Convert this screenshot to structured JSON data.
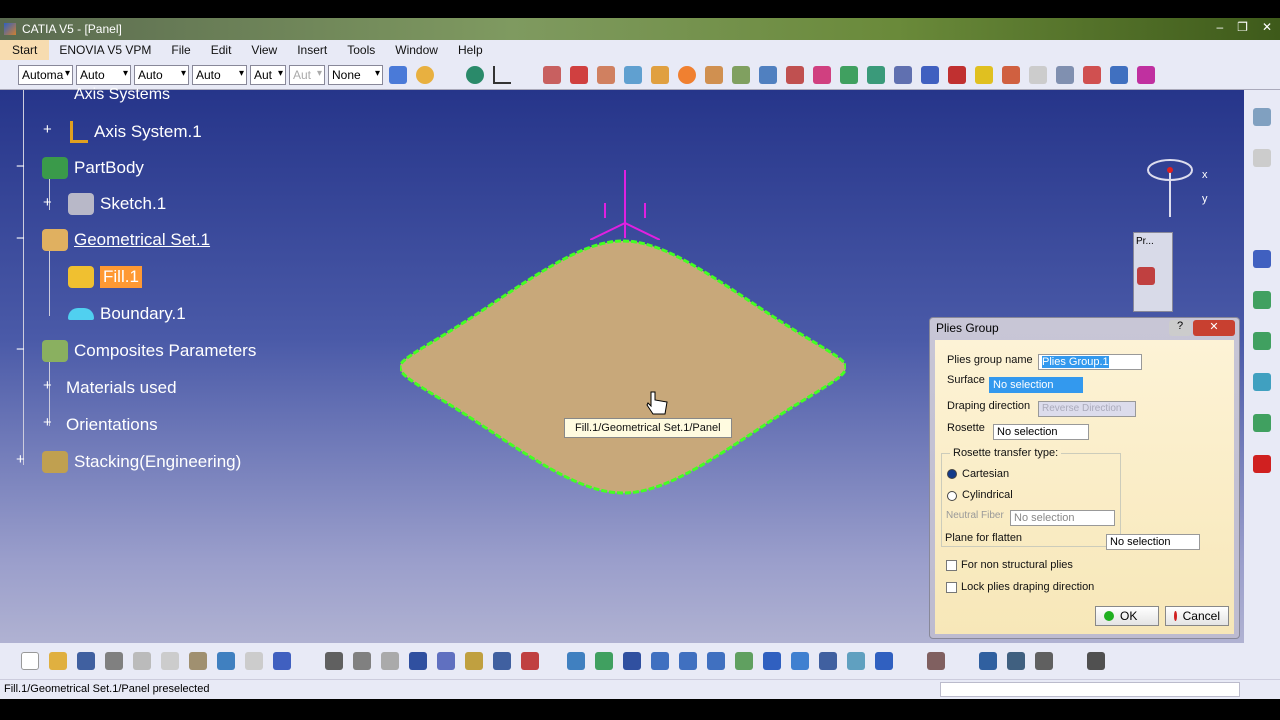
{
  "window": {
    "title": "CATIA V5 - [Panel]",
    "controls": [
      "–",
      "❐",
      "✕"
    ]
  },
  "menu": {
    "items": [
      "Start",
      "ENOVIA V5 VPM",
      "File",
      "Edit",
      "View",
      "Insert",
      "Tools",
      "Window",
      "Help"
    ]
  },
  "toolbar": {
    "selects": [
      "Automa",
      "Auto",
      "Auto",
      "Auto",
      "Aut",
      "Aut",
      "None"
    ]
  },
  "tree": {
    "items": [
      {
        "label": "Axis Systems"
      },
      {
        "label": "Axis System.1"
      },
      {
        "label": "PartBody"
      },
      {
        "label": "Sketch.1"
      },
      {
        "label": "Geometrical Set.1"
      },
      {
        "label": "Fill.1"
      },
      {
        "label": "Boundary.1"
      },
      {
        "label": "Composites Parameters"
      },
      {
        "label": "Materials used"
      },
      {
        "label": "Orientations"
      },
      {
        "label": "Stacking(Engineering)"
      }
    ]
  },
  "viewport": {
    "tooltip": "Fill.1/Geometrical Set.1/Panel",
    "compass": {
      "x": "x",
      "y": "y"
    },
    "mini_panel": "Pr..."
  },
  "dialog": {
    "title": "Plies Group",
    "help": "?",
    "close": "✕",
    "plies_group_name_label": "Plies group name",
    "plies_group_name_value": "Plies Group.1",
    "surface_label": "Surface",
    "surface_value": "No selection",
    "draping_label": "Draping direction",
    "reverse_button": "Reverse Direction",
    "rosette_label": "Rosette",
    "rosette_value": "No selection",
    "transfer_group": "Rosette transfer type:",
    "cartesian": "Cartesian",
    "cylindrical": "Cylindrical",
    "transfer_selected": "Cartesian",
    "neutral_label": "Neutral Fiber",
    "neutral_value": "No selection",
    "plane_label": "Plane for flatten",
    "plane_value": "No selection",
    "non_structural": "For non structural plies",
    "non_structural_checked": false,
    "lock_draping": "Lock plies draping direction",
    "lock_draping_checked": false,
    "ok": "OK",
    "cancel": "Cancel"
  },
  "colors": {
    "viewport_top": "#26358a",
    "surface": "#c8a87a",
    "boundary": "#44ff22",
    "highlight": "#3399ee",
    "selected_node": "#ff9933"
  },
  "status": {
    "text": "Fill.1/Geometrical Set.1/Panel preselected"
  }
}
